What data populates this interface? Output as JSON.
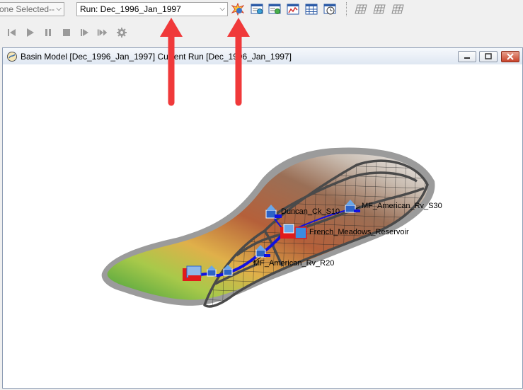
{
  "toolbar": {
    "scenario_value": "one Selected--",
    "run_value": "Run: Dec_1996_Jan_1997",
    "compute_icons": [
      "compute-current-run-icon",
      "global-summary-icon",
      "element-table-icon",
      "graph-icon",
      "summary-table-icon",
      "time-series-icon"
    ],
    "grid_icons": [
      "grid-icon",
      "grid-icon",
      "grid-icon"
    ],
    "run_controls": [
      "step-back-icon",
      "play-icon",
      "pause-icon",
      "stop-icon",
      "step-forward-icon",
      "fast-forward-icon",
      "settings-gear-icon"
    ]
  },
  "window": {
    "title": "Basin Model [Dec_1996_Jan_1997] Current Run [Dec_1996_Jan_1997]"
  },
  "map": {
    "labels": {
      "duncan": "Duncan_Ck_S10",
      "mf_s30": "MF_American_Rv_S30",
      "reservoir": "French_Meadows_Reservoir",
      "mf_r20": "MF_American_Rv_R20"
    }
  },
  "annotations": {
    "arrow_color": "#f0393a"
  }
}
